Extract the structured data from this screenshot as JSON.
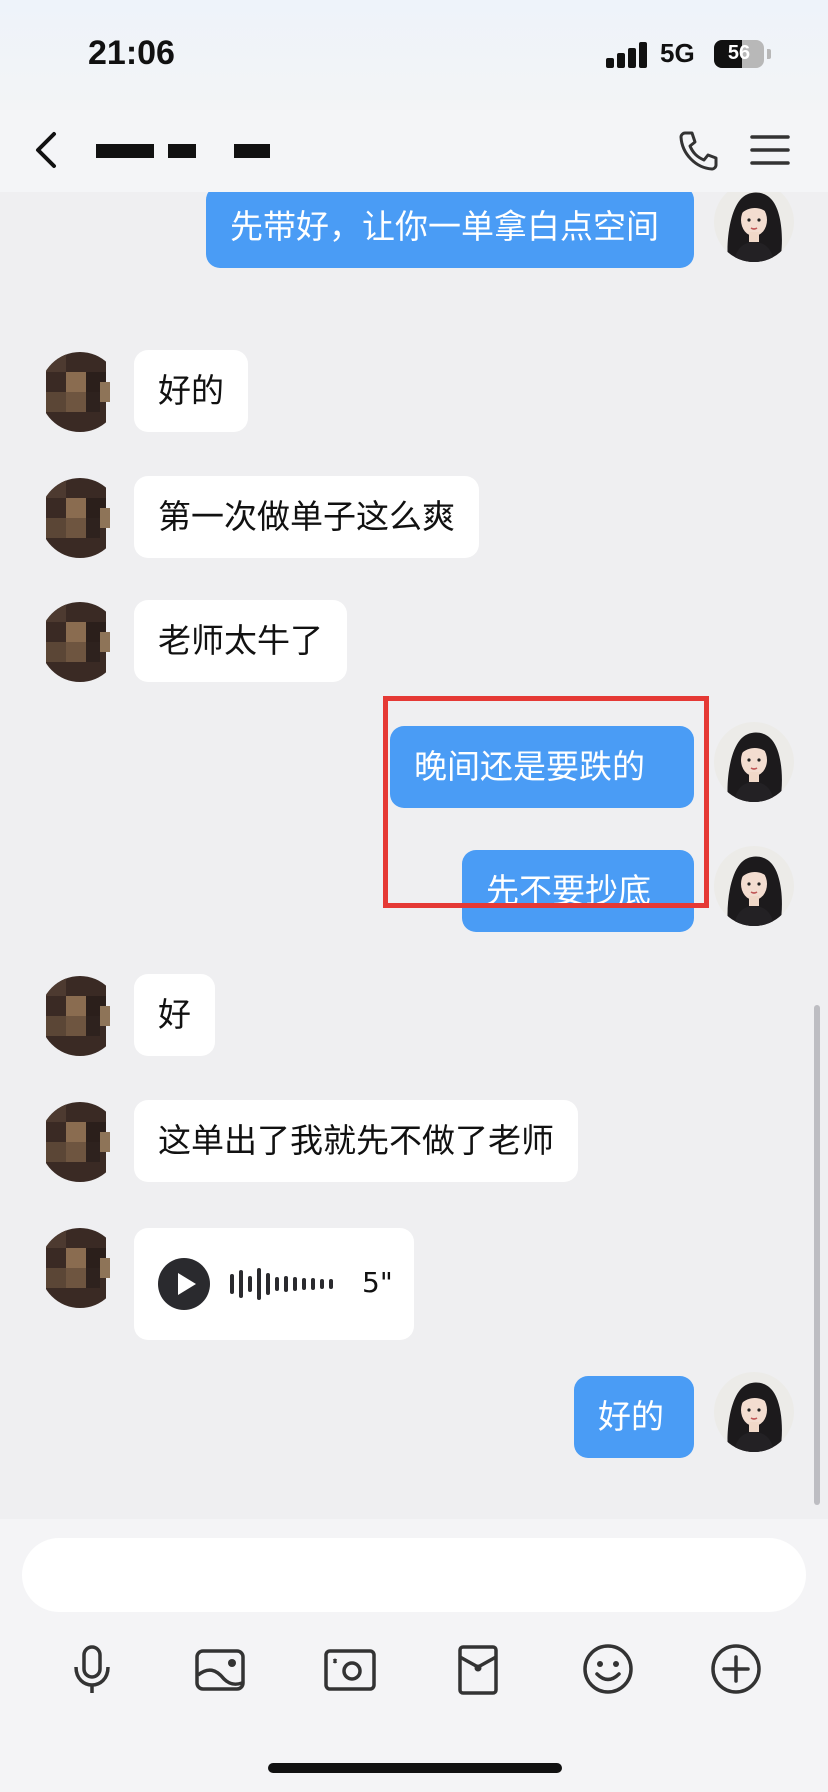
{
  "status_bar": {
    "time": "21:06",
    "network": "5G",
    "battery": "56",
    "battery_level": 0.56
  },
  "header": {
    "title": ""
  },
  "messages": [
    {
      "side": "out",
      "text": "先带好，让你一单拿白点空间"
    },
    {
      "side": "in",
      "text": "好的"
    },
    {
      "side": "in",
      "text": "第一次做单子这么爽"
    },
    {
      "side": "in",
      "text": "老师太牛了"
    },
    {
      "side": "out",
      "text": "晚间还是要跌的"
    },
    {
      "side": "out",
      "text": "先不要抄底"
    },
    {
      "side": "in",
      "text": "好"
    },
    {
      "side": "in",
      "text": "这单出了我就先不做了老师"
    },
    {
      "side": "in",
      "type": "voice",
      "duration": "5\""
    },
    {
      "side": "out",
      "text": "好的"
    }
  ],
  "composer": {
    "placeholder": ""
  },
  "toolbar": [
    "microphone-icon",
    "image-icon",
    "camera-icon",
    "red-packet-icon",
    "emoji-icon",
    "plus-icon"
  ],
  "colors": {
    "outgoing_bubble": "#4a9cf5",
    "incoming_bubble": "#ffffff",
    "highlight": "#e53935"
  }
}
